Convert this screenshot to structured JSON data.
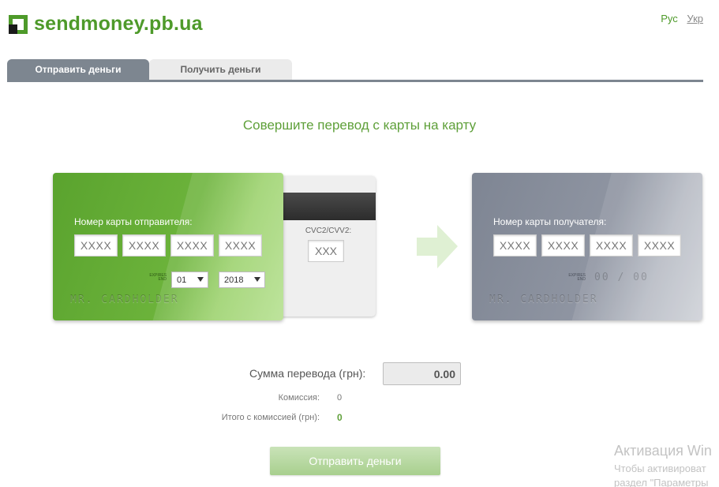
{
  "header": {
    "logo_text": "sendmoney.pb.ua",
    "lang_active": "Рус",
    "lang_other": "Укр"
  },
  "tabs": [
    {
      "label": "Отправить деньги",
      "active": true
    },
    {
      "label": "Получить деньги",
      "active": false
    }
  ],
  "main": {
    "title": "Совершите перевод с карты на карту"
  },
  "sender_card": {
    "label": "Номер карты отправителя:",
    "placeholders": [
      "XXXX",
      "XXXX",
      "XXXX",
      "XXXX"
    ],
    "expires_label": "EXPIRES END",
    "month": "01",
    "year": "2018",
    "holder": "MR. CARDHOLDER"
  },
  "cvc": {
    "label": "CVC2/CVV2:",
    "placeholder": "XXX"
  },
  "receiver_card": {
    "label": "Номер карты получателя:",
    "placeholders": [
      "XXXX",
      "XXXX",
      "XXXX",
      "XXXX"
    ],
    "expires_label": "EXPIRES END",
    "expiry_placeholder": "00 / 00",
    "holder": "MR. CARDHOLDER"
  },
  "summary": {
    "amount_label": "Сумма перевода (грн):",
    "amount_value": "0.00",
    "fee_label": "Комиссия:",
    "fee_value": "0",
    "total_label": "Итого с комиссией (грн):",
    "total_value": "0"
  },
  "send_button": "Отправить деньги",
  "watermark": {
    "title": "Активация Win",
    "line1": "Чтобы активироват",
    "line2": "раздел \"Параметры"
  },
  "colors": {
    "brand_green": "#4e9a2a",
    "tab_active": "#7d8690",
    "title_green": "#5fa03a"
  },
  "icons": {
    "logo": "privatbank-logo-icon",
    "arrow": "arrow-right-icon",
    "select": "chevron-down-icon"
  }
}
